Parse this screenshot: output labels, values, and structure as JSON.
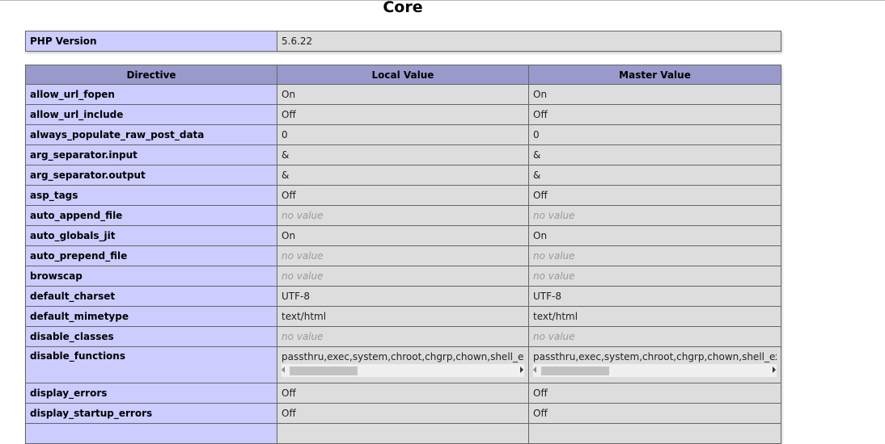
{
  "section": {
    "title": "Core"
  },
  "version_row": {
    "label": "PHP Version",
    "value": "5.6.22"
  },
  "headers": {
    "directive": "Directive",
    "local": "Local Value",
    "master": "Master Value"
  },
  "rows": [
    {
      "name": "allow_url_fopen",
      "local": "On",
      "master": "On",
      "novalue": false
    },
    {
      "name": "allow_url_include",
      "local": "Off",
      "master": "Off",
      "novalue": false
    },
    {
      "name": "always_populate_raw_post_data",
      "local": "0",
      "master": "0",
      "novalue": false
    },
    {
      "name": "arg_separator.input",
      "local": "&",
      "master": "&",
      "novalue": false
    },
    {
      "name": "arg_separator.output",
      "local": "&",
      "master": "&",
      "novalue": false
    },
    {
      "name": "asp_tags",
      "local": "Off",
      "master": "Off",
      "novalue": false
    },
    {
      "name": "auto_append_file",
      "local": "no value",
      "master": "no value",
      "novalue": true
    },
    {
      "name": "auto_globals_jit",
      "local": "On",
      "master": "On",
      "novalue": false
    },
    {
      "name": "auto_prepend_file",
      "local": "no value",
      "master": "no value",
      "novalue": true
    },
    {
      "name": "browscap",
      "local": "no value",
      "master": "no value",
      "novalue": true
    },
    {
      "name": "default_charset",
      "local": "UTF-8",
      "master": "UTF-8",
      "novalue": false
    },
    {
      "name": "default_mimetype",
      "local": "text/html",
      "master": "text/html",
      "novalue": false
    },
    {
      "name": "disable_classes",
      "local": "no value",
      "master": "no value",
      "novalue": true
    },
    {
      "name": "disable_functions",
      "local": "passthru,exec,system,chroot,chgrp,chown,shell_exec,p",
      "master": "passthru,exec,system,chroot,chgrp,chown,shell_exec,p",
      "novalue": false,
      "scroll": true
    },
    {
      "name": "display_errors",
      "local": "Off",
      "master": "Off",
      "novalue": false
    },
    {
      "name": "display_startup_errors",
      "local": "Off",
      "master": "Off",
      "novalue": false
    },
    {
      "name": "",
      "local": "",
      "master": "",
      "novalue": false
    }
  ]
}
